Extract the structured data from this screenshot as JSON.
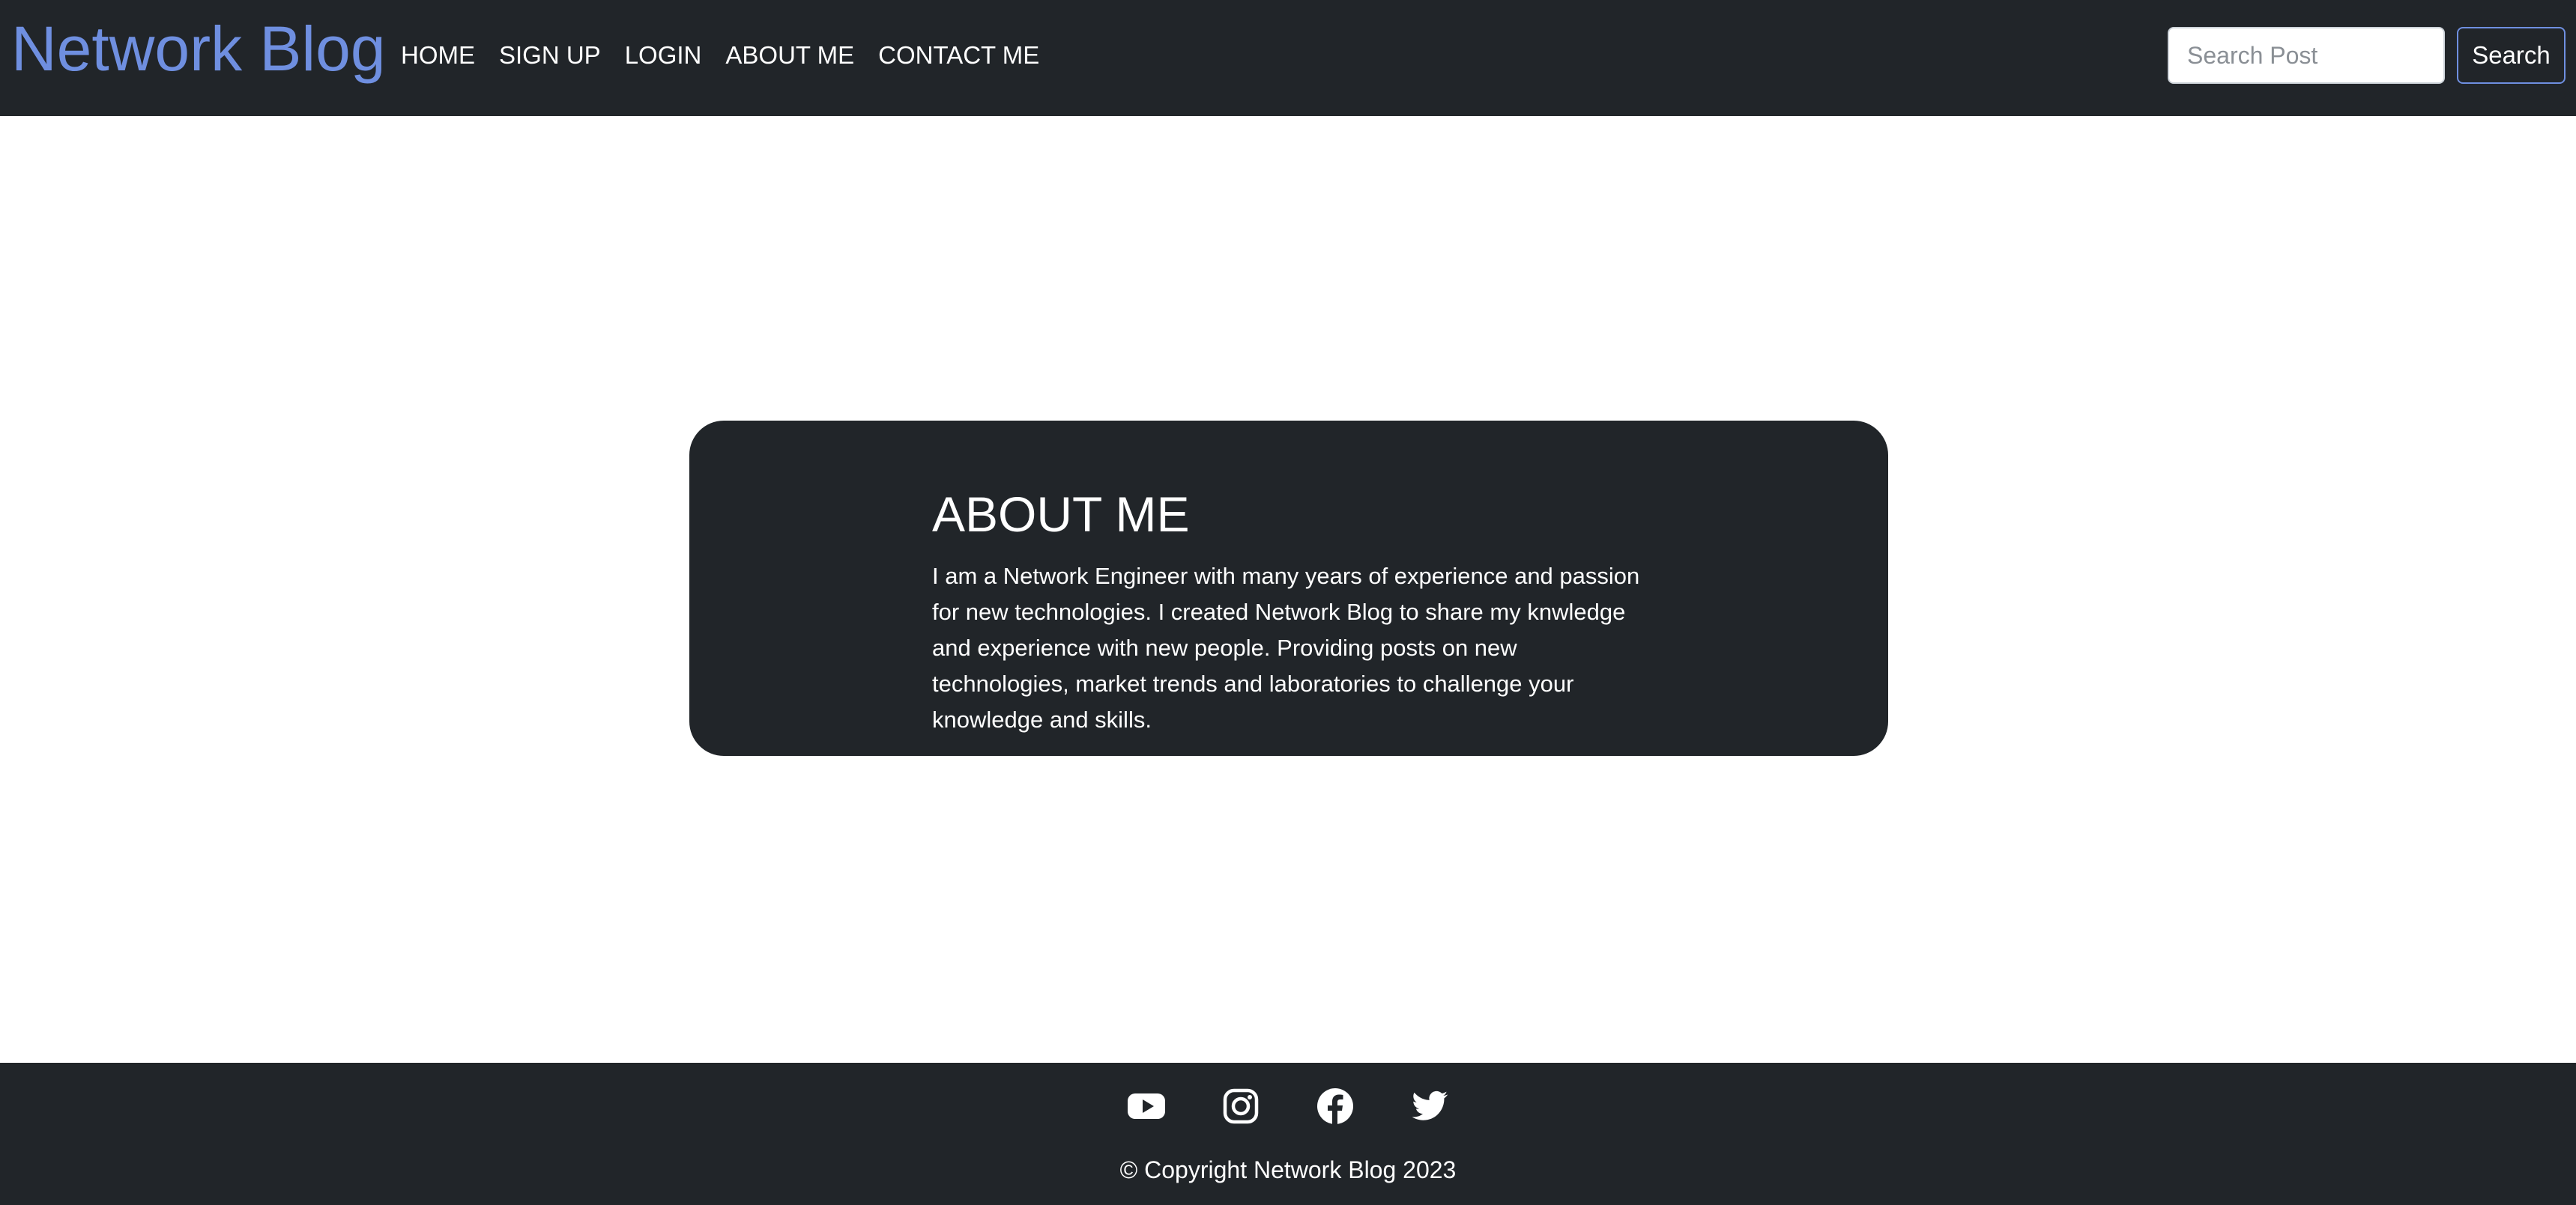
{
  "navbar": {
    "brand": "Network Blog",
    "links": [
      {
        "label": "HOME"
      },
      {
        "label": "SIGN UP"
      },
      {
        "label": "LOGIN"
      },
      {
        "label": "ABOUT ME"
      },
      {
        "label": "CONTACT ME"
      }
    ],
    "search": {
      "placeholder": "Search Post",
      "value": "",
      "button_label": "Search"
    }
  },
  "about": {
    "title": "ABOUT ME",
    "text": "I am a Network Engineer with many years of experience and passion for new technologies. I created Network Blog to share my knwledge and experience with new people. Providing posts on new technologies, market trends and laboratories to challenge your knowledge and skills."
  },
  "footer": {
    "social_icons": [
      "youtube-icon",
      "instagram-icon",
      "facebook-icon",
      "twitter-icon"
    ],
    "copyright": "© Copyright Network Blog 2023"
  },
  "colors": {
    "dark": "#212529",
    "brand": "#6f8fe0",
    "background": "#ffffff"
  }
}
